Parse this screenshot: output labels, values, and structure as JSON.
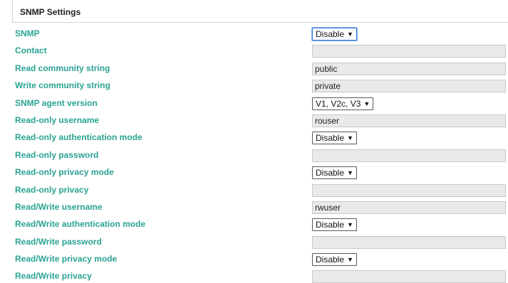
{
  "section": {
    "title": "SNMP Settings"
  },
  "rows": [
    {
      "label": "SNMP",
      "type": "select",
      "value": "Disable"
    },
    {
      "label": "Contact",
      "type": "input",
      "value": ""
    },
    {
      "label": "Read community string",
      "type": "input",
      "value": "public"
    },
    {
      "label": "Write community string",
      "type": "input",
      "value": "private"
    },
    {
      "label": "SNMP agent version",
      "type": "select",
      "value": "V1, V2c, V3"
    },
    {
      "label": "Read-only username",
      "type": "input",
      "value": "rouser"
    },
    {
      "label": "Read-only authentication mode",
      "type": "select",
      "value": "Disable"
    },
    {
      "label": "Read-only password",
      "type": "input",
      "value": ""
    },
    {
      "label": "Read-only privacy mode",
      "type": "select",
      "value": "Disable"
    },
    {
      "label": "Read-only privacy",
      "type": "input",
      "value": ""
    },
    {
      "label": "Read/Write username",
      "type": "input",
      "value": "rwuser"
    },
    {
      "label": "Read/Write authentication mode",
      "type": "select",
      "value": "Disable"
    },
    {
      "label": "Read/Write password",
      "type": "input",
      "value": ""
    },
    {
      "label": "Read/Write privacy mode",
      "type": "select",
      "value": "Disable"
    },
    {
      "label": "Read/Write privacy",
      "type": "input",
      "value": ""
    }
  ],
  "colors": {
    "label": "#2aa393",
    "field_background": "#e9e9e9",
    "focus_border": "#3d7fd8"
  },
  "icons": {
    "dropdown": "triangle-down-icon"
  }
}
